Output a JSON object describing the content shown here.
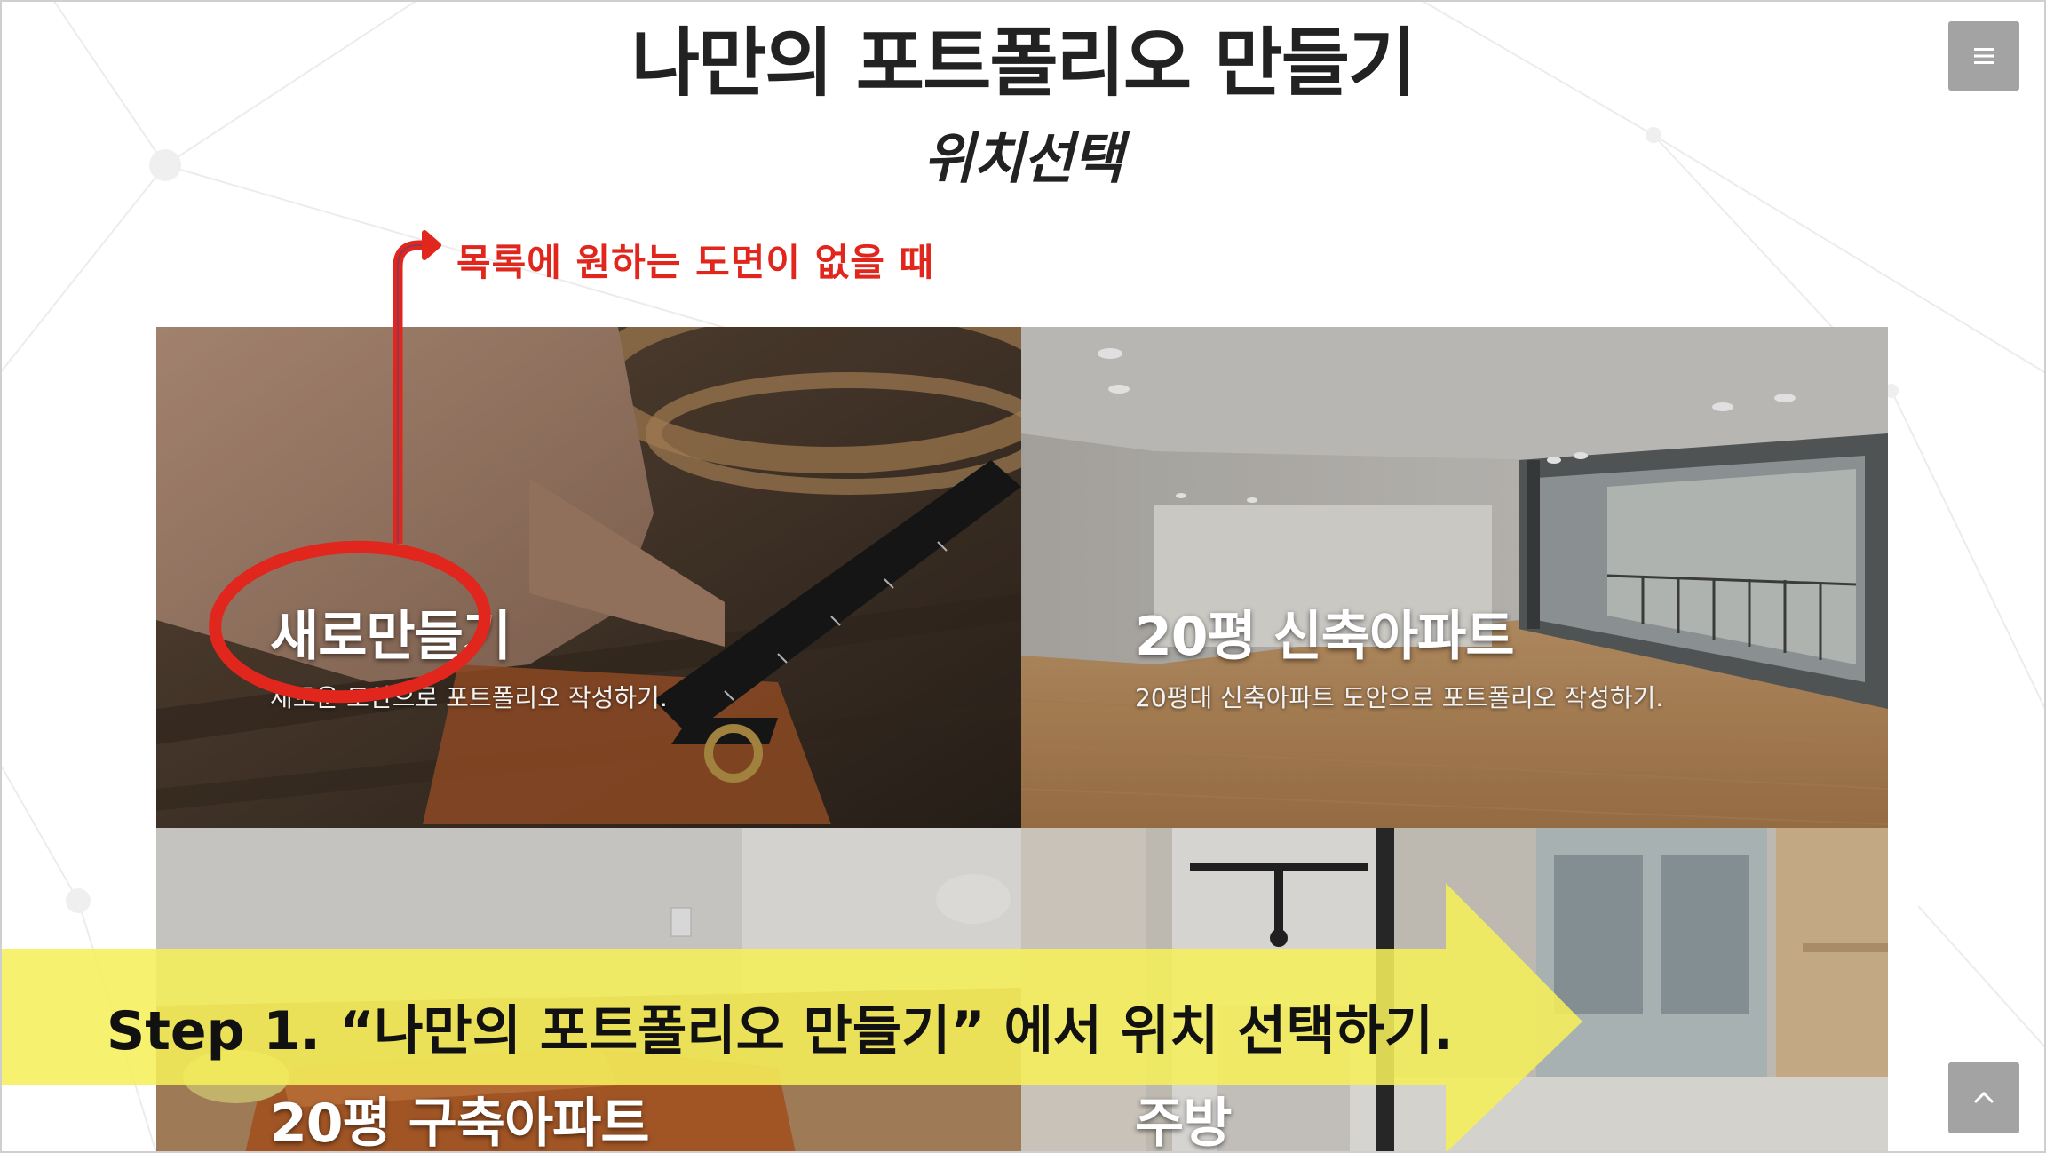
{
  "header": {
    "title": "나만의 포트폴리오 만들기",
    "subtitle": "위치선택",
    "menu_icon": "hamburger-icon",
    "top_icon": "chevron-up-icon"
  },
  "annotation": {
    "callout": "목록에 원하는 도면이 없을 때",
    "callout_color": "#e0261d",
    "step_banner": "Step 1. “나만의 포트폴리오 만들기” 에서 위치 선택하기.",
    "banner_color": "#f5ef5a"
  },
  "tiles": [
    {
      "title": "새로만들기",
      "desc": "새로운 도안으로 포트폴리오 작성하기."
    },
    {
      "title": "20평 신축아파트",
      "desc": "20평대 신축아파트 도안으로 포트폴리오 작성하기."
    },
    {
      "title": "20평 구축아파트",
      "desc": ""
    },
    {
      "title": "주방",
      "desc": ""
    }
  ]
}
